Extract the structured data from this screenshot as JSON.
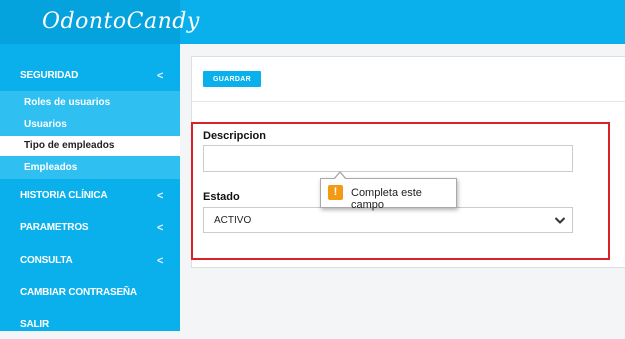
{
  "brand": {
    "name": "OdontoCandy"
  },
  "sidebar": {
    "sections": [
      {
        "label": "SEGURIDAD",
        "chevron": "<"
      },
      {
        "label": "HISTORIA CLÍNICA",
        "chevron": "<"
      },
      {
        "label": "PARAMETROS",
        "chevron": "<"
      },
      {
        "label": "CONSULTA",
        "chevron": "<"
      },
      {
        "label": "CAMBIAR CONTRASEÑA"
      },
      {
        "label": "SALIR"
      }
    ],
    "submenu": [
      {
        "label": "Roles de usuarios"
      },
      {
        "label": "Usuarios"
      },
      {
        "label": "Tipo de empleados",
        "active": true
      },
      {
        "label": "Empleados"
      }
    ]
  },
  "form": {
    "save_label": "GUARDAR",
    "description_label": "Descripcion",
    "description_value": "",
    "state_label": "Estado",
    "state_value": "ACTIVO"
  },
  "tooltip": {
    "icon": "!",
    "message": "Completa este campo"
  },
  "colors": {
    "primary": "#0ab0ec",
    "brand_bg": "#05a3de",
    "submenu_bg": "#2fc0f1",
    "highlight": "#d7222a",
    "warning": "#f39a14"
  }
}
